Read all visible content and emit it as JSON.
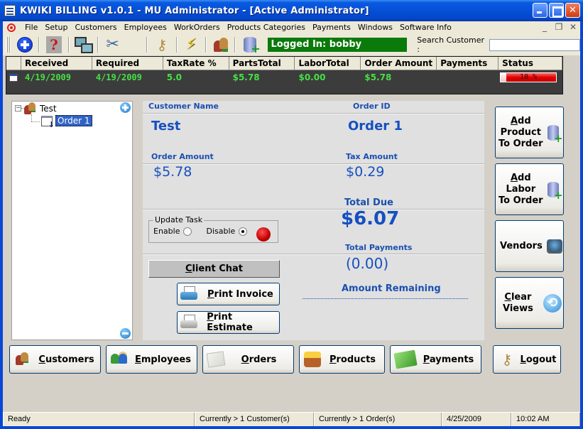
{
  "window": {
    "title": "KWIKI BILLING v1.0.1 - MU Administrator - [Active Administrator]"
  },
  "menu": {
    "items": [
      "File",
      "Setup",
      "Customers",
      "Employees",
      "WorkOrders",
      "Products Categories",
      "Payments",
      "Windows",
      "Software Info"
    ]
  },
  "toolbar": {
    "logged_in_text": "Logged In:  bobby",
    "search_label": "Search Customer :",
    "search_value": "",
    "icons": [
      "add-icon",
      "help-icon",
      "network-icon",
      "tools-icon",
      "keys-icon",
      "lightning-icon",
      "users-icon",
      "database-add-icon"
    ]
  },
  "grid": {
    "columns": [
      "Received",
      "Required",
      "TaxRate %",
      "PartsTotal",
      "LaborTotal",
      "Order Amount",
      "Payments",
      "Status"
    ],
    "rows": [
      {
        "received": "4/19/2009",
        "required": "4/19/2009",
        "taxrate": "5.0",
        "parts_total": "$5.78",
        "labor_total": "$0.00",
        "order_amount": "$5.78",
        "payments": "",
        "status_text": "10 %",
        "status_percent": 10
      }
    ]
  },
  "tree": {
    "customer": "Test",
    "order": "Order 1"
  },
  "details": {
    "customer_name_label": "Customer Name",
    "customer_name": "Test",
    "order_id_label": "Order ID",
    "order_id": "Order  1",
    "order_amount_label": "Order Amount",
    "order_amount": "$5.78",
    "tax_amount_label": "Tax Amount",
    "tax_amount": "$0.29",
    "total_due_label": "Total Due",
    "total_due": "$6.07",
    "total_payments_label": "Total Payments",
    "total_payments": "(0.00)",
    "amount_remaining_label": "Amount Remaining",
    "amount_remaining": "",
    "update_task": {
      "legend": "Update Task",
      "enable_label": "Enable",
      "disable_label": "Disable",
      "selected": "Disable"
    },
    "client_chat_hotkey": "C",
    "client_chat_rest": "lient Chat",
    "print_invoice_hotkey": "P",
    "print_invoice_rest": "rint Invoice",
    "print_estimate_hotkey": "P",
    "print_estimate_rest": "rint Estimate"
  },
  "side_buttons": {
    "add_product": {
      "hotkey": "A",
      "line1_rest": "dd",
      "line2": "Product",
      "line3": "To Order"
    },
    "add_labor": {
      "hotkey": "A",
      "line1_rest": "dd",
      "line2": "Labor",
      "line3": "To Order"
    },
    "vendors": "Vendors",
    "clear_views": {
      "hotkey": "C",
      "line1_rest": "lear",
      "line2": "Views"
    }
  },
  "nav_buttons": [
    {
      "hotkey": "C",
      "rest": "ustomers"
    },
    {
      "hotkey": "E",
      "rest": "mployees"
    },
    {
      "hotkey": "O",
      "rest": "rders"
    },
    {
      "hotkey": "P",
      "rest": "roducts"
    },
    {
      "hotkey": "P",
      "rest": "ayments"
    },
    {
      "hotkey": "L",
      "rest": "ogout"
    }
  ],
  "statusbar": {
    "state": "Ready",
    "customers": "Currently > 1 Customer(s)",
    "orders": "Currently > 1 Order(s)",
    "date": "4/25/2009",
    "time": "10:02 AM"
  }
}
